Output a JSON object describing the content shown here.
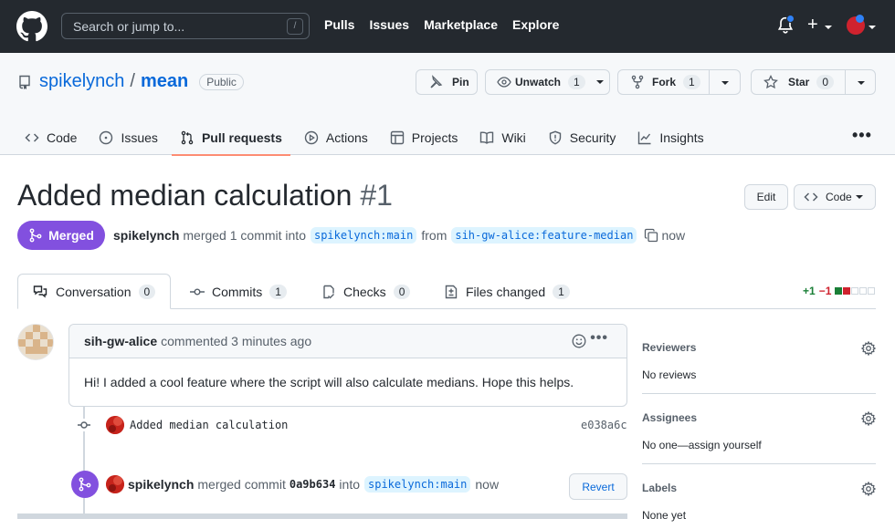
{
  "topbar": {
    "search_placeholder": "Search or jump to...",
    "search_key": "/",
    "nav": [
      "Pulls",
      "Issues",
      "Marketplace",
      "Explore"
    ],
    "plus": "+"
  },
  "repo": {
    "owner": "spikelynch",
    "separator": "/",
    "name": "mean",
    "visibility": "Public",
    "actions": {
      "pin": "Pin",
      "unwatch": "Unwatch",
      "unwatch_count": "1",
      "fork": "Fork",
      "fork_count": "1",
      "star": "Star",
      "star_count": "0"
    },
    "tabs": [
      "Code",
      "Issues",
      "Pull requests",
      "Actions",
      "Projects",
      "Wiki",
      "Security",
      "Insights"
    ],
    "active_tab": "Pull requests"
  },
  "pr": {
    "title": "Added median calculation",
    "number": "#1",
    "edit_label": "Edit",
    "code_label": "Code",
    "state": "Merged",
    "merged_by": "spikelynch",
    "merged_text": "merged 1 commit into",
    "base_branch": "spikelynch:main",
    "from_text": "from",
    "head_branch": "sih-gw-alice:feature-median",
    "time": "now",
    "tabs": [
      {
        "label": "Conversation",
        "count": "0"
      },
      {
        "label": "Commits",
        "count": "1"
      },
      {
        "label": "Checks",
        "count": "0"
      },
      {
        "label": "Files changed",
        "count": "1"
      }
    ],
    "additions": "+1",
    "deletions": "−1"
  },
  "timeline": {
    "comment": {
      "author": "sih-gw-alice",
      "meta": "commented 3 minutes ago",
      "body": "Hi! I added a cool feature where the script will also calculate medians. Hope this helps."
    },
    "commit": {
      "message": "Added median calculation",
      "sha": "e038a6c"
    },
    "merge": {
      "author": "spikelynch",
      "text": "merged commit",
      "sha": "0a9b634",
      "into": "into",
      "branch": "spikelynch:main",
      "time": "now",
      "revert_label": "Revert"
    }
  },
  "sidebar": {
    "reviewers": {
      "label": "Reviewers",
      "value": "No reviews"
    },
    "assignees": {
      "label": "Assignees",
      "value": "No one—assign yourself"
    },
    "labels": {
      "label": "Labels",
      "value": "None yet"
    }
  },
  "colors": {
    "header_bg": "#24292f",
    "merged_purple": "#8250df",
    "link_blue": "#0969da",
    "active_tab_underline": "#fd8c73",
    "add_green": "#1a7f37",
    "del_red": "#cf222e"
  }
}
